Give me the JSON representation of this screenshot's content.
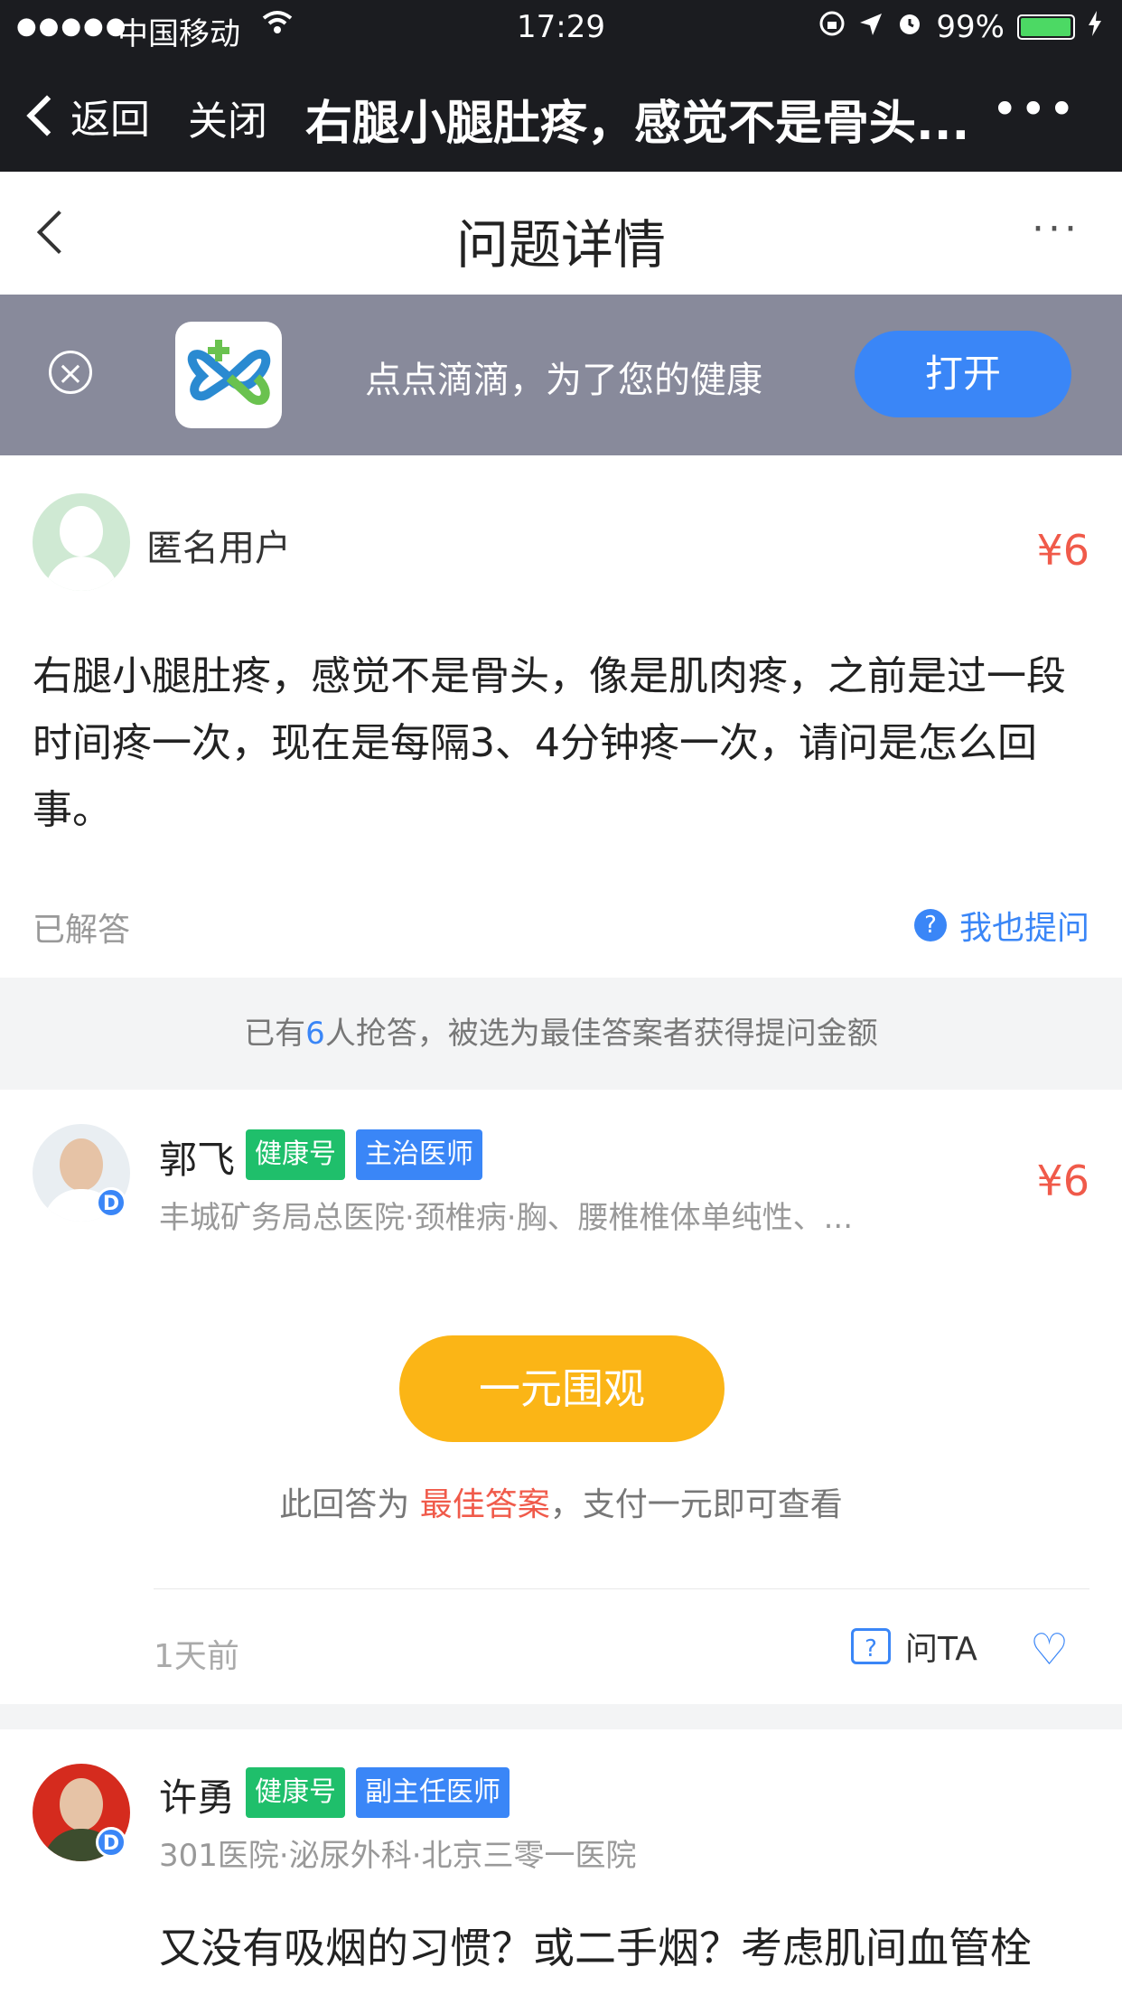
{
  "status_bar": {
    "signal": "●●●●●",
    "carrier": "中国移动",
    "time": "17:29",
    "battery": "99%",
    "battery_level": 0.99
  },
  "wechat_nav": {
    "back_label": "返回",
    "close_label": "关闭",
    "title": "右腿小腿肚疼，感觉不是骨头...",
    "more": "•••"
  },
  "page": {
    "title": "问题详情",
    "more": "···"
  },
  "banner": {
    "close": "×",
    "slogan": "点点滴滴，为了您的健康",
    "open_label": "打开"
  },
  "question": {
    "user": "匿名用户",
    "price": "¥6",
    "text": "右腿小腿肚疼，感觉不是骨头，像是肌肉疼，之前是过一段时间疼一次，现在是每隔3、4分钟疼一次，请问是怎么回事。",
    "status": "已解答",
    "ask_also": "我也提问",
    "ask_icon": "?"
  },
  "notice": {
    "prefix": "已有",
    "count": "6",
    "suffix": "人抢答，被选为最佳答案者获得提问金额"
  },
  "answers": [
    {
      "name": "郭飞",
      "tag1": "健康号",
      "tag2": "主治医师",
      "info": "丰城矿务局总医院·颈椎病·胸、腰椎椎体单纯性、...",
      "price": "¥6",
      "badge": "D",
      "watch_label": "一元围观",
      "note_prefix": "此回答为 ",
      "note_best": "最佳答案",
      "note_suffix": "，支付一元即可查看",
      "time": "1天前",
      "ask_ta": "问TA",
      "ask_ta_icon": "?",
      "heart": "♡"
    },
    {
      "name": "许勇",
      "tag1": "健康号",
      "tag2": "副主任医师",
      "info": "301医院·泌尿外科·北京三零一医院",
      "badge": "D",
      "text": "又没有吸烟的习惯？或二手烟？考虑肌间血管栓"
    }
  ]
}
